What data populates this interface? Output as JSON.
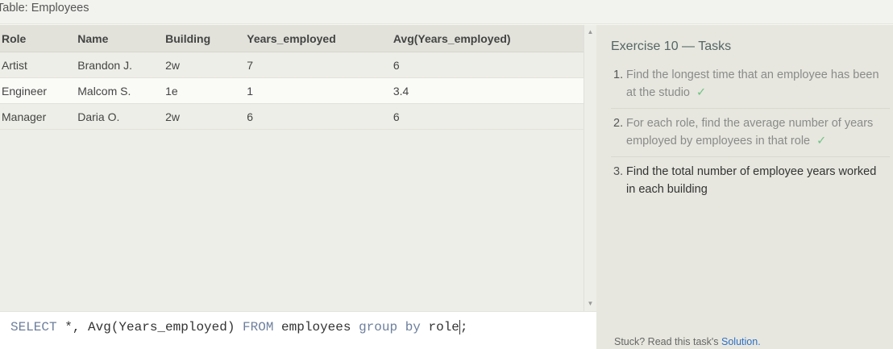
{
  "table_title": "Table: Employees",
  "results": {
    "columns": [
      "Role",
      "Name",
      "Building",
      "Years_employed",
      "Avg(Years_employed)"
    ],
    "rows": [
      [
        "Artist",
        "Brandon J.",
        "2w",
        "7",
        "6"
      ],
      [
        "Engineer",
        "Malcom S.",
        "1e",
        "1",
        "3.4"
      ],
      [
        "Manager",
        "Daria O.",
        "2w",
        "6",
        "6"
      ]
    ]
  },
  "editor": {
    "tokens": [
      {
        "text": "SELECT",
        "kind": "keyword"
      },
      {
        "text": " *, Avg(Years_employed) ",
        "kind": "plain"
      },
      {
        "text": "FROM",
        "kind": "keyword"
      },
      {
        "text": " employees ",
        "kind": "plain"
      },
      {
        "text": "group by",
        "kind": "keyword"
      },
      {
        "text": " role",
        "kind": "plain"
      },
      {
        "text": ";",
        "kind": "plain"
      }
    ]
  },
  "exercise": {
    "title": "Exercise 10 — Tasks",
    "tasks": [
      {
        "num": "1.",
        "text": "Find the longest time that an employee has been at the studio",
        "done": true
      },
      {
        "num": "2.",
        "text": "For each role, find the average number of years employed by employees in that role",
        "done": true
      },
      {
        "num": "3.",
        "text": "Find the total number of employee years worked in each building",
        "done": false
      }
    ],
    "check_mark": "✓",
    "stuck_text": "Stuck? Read this task's",
    "solution_link": "Solution."
  }
}
